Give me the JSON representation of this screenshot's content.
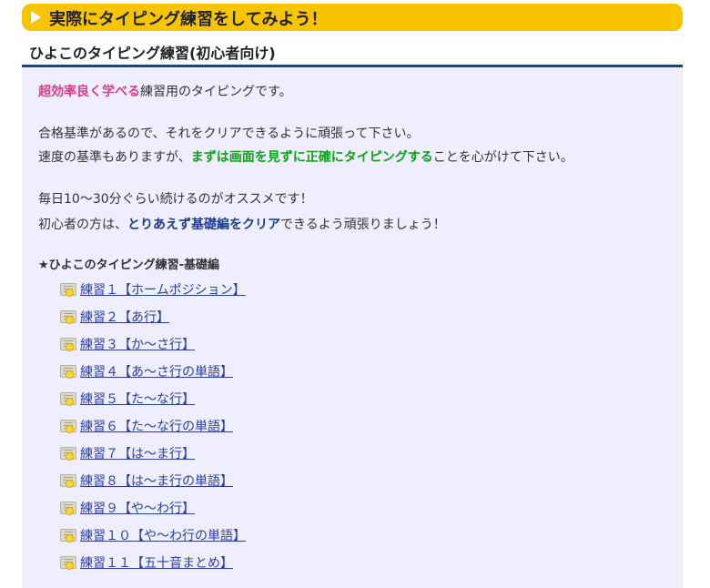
{
  "banner": {
    "title": "実際にタイピング練習をしてみよう！"
  },
  "subheading": "ひよこのタイピング練習(初心者向け)",
  "intro": {
    "p1_em": "超効率良く学べる",
    "p1_rest": "練習用のタイピングです。",
    "p2": "合格基準があるので、それをクリアできるように頑張って下さい。",
    "p3_pre": "速度の基準もありますが、",
    "p3_em": "まずは画面を見ずに正確にタイピングする",
    "p3_post": "ことを心がけて下さい。",
    "p4": "毎日10〜30分ぐらい続けるのがオススメです！",
    "p5_pre": "初心者の方は、",
    "p5_em": "とりあえず基礎編をクリア",
    "p5_post": "できるよう頑張りましょう！"
  },
  "section": {
    "title": "★ひよこのタイピング練習-基礎編",
    "lessons": [
      "練習１【ホームポジション】",
      "練習２【あ行】",
      "練習３【か〜さ行】",
      "練習４【あ〜さ行の単語】",
      "練習５【た〜な行】",
      "練習６【た〜な行の単語】",
      "練習７【は〜ま行】",
      "練習８【は〜ま行の単語】",
      "練習９【や〜わ行】",
      "練習１０【や〜わ行の単語】",
      "練習１１【五十音まとめ】"
    ]
  },
  "colors": {
    "banner": "#f7c400",
    "link": "#2b3fa5",
    "pink": "#e23a8a",
    "green": "#12a01e",
    "navy": "#1e3d8f"
  },
  "icons": {
    "banner_arrow": "play-arrow-icon",
    "lesson_icon": "book-chick-icon"
  }
}
